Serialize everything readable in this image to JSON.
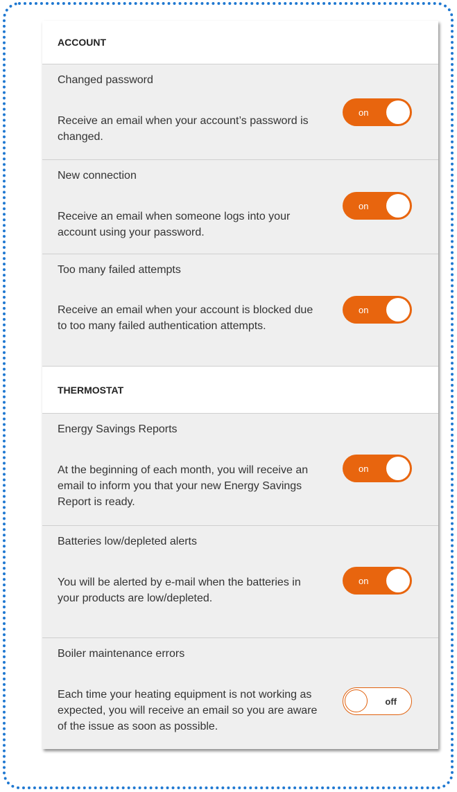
{
  "sections": [
    {
      "header": "ACCOUNT",
      "items": [
        {
          "title": "Changed password",
          "desc": "Receive an email when your account’s password is changed.",
          "toggle": "on"
        },
        {
          "title": "New connection",
          "desc": "Receive an email when someone logs into your account using your password.",
          "toggle": "on"
        },
        {
          "title": "Too many failed attempts",
          "desc": "Receive an email when your account is blocked due to too many failed authentication attempts.",
          "toggle": "on"
        }
      ]
    },
    {
      "header": "THERMOSTAT",
      "items": [
        {
          "title": "Energy Savings Reports",
          "desc": "At the beginning of each month, you will receive an email to inform you that your new Energy Savings Report is ready.",
          "toggle": "on"
        },
        {
          "title": "Batteries low/depleted alerts",
          "desc": "You will be alerted by e-mail when the batteries in your products are low/depleted.",
          "toggle": "on"
        },
        {
          "title": "Boiler maintenance errors",
          "desc": "Each time your heating equipment is not working as expected, you will receive an email so you are aware of the issue as soon as possible.",
          "toggle": "off"
        }
      ]
    }
  ],
  "colors": {
    "accent": "#e8650e",
    "frame": "#1f78d1"
  }
}
